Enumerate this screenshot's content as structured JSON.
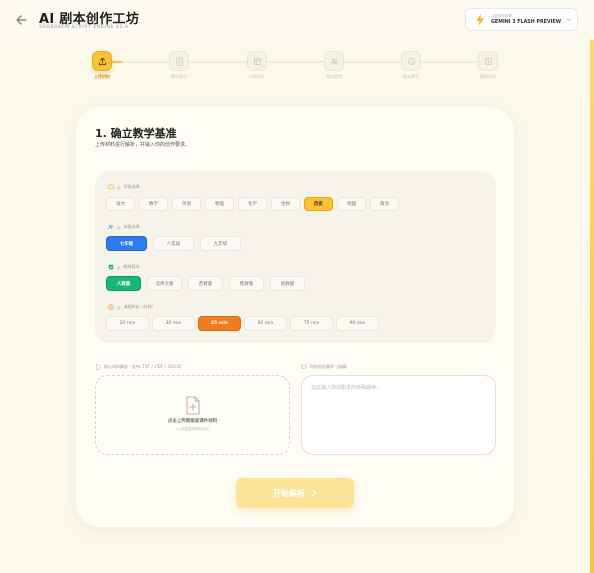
{
  "header": {
    "title": "AI 剧本创作工坊",
    "subtitle": "SOURDACM SCRIPT ENGINE V2.0",
    "model_picker": {
      "caption": "当前使用引擎",
      "model_name": "GEMINI 3 FLASH PREVIEW",
      "accent_color": "#f5b820"
    }
  },
  "stepper": {
    "progress_fraction": 0.0,
    "steps": [
      {
        "label": "上传材料",
        "icon": "upload-icon",
        "active": true
      },
      {
        "label": "教学要点",
        "icon": "doc-icon",
        "active": false
      },
      {
        "label": "大纲设计",
        "icon": "outline-icon",
        "active": false
      },
      {
        "label": "角色塑造",
        "icon": "people-icon",
        "active": false
      },
      {
        "label": "剧本撰写",
        "icon": "pen-icon",
        "active": false
      },
      {
        "label": "最终导出",
        "icon": "export-icon",
        "active": false
      }
    ]
  },
  "section": {
    "title": "1. 确立教学基准",
    "description": "上传材料进行解析，并输入你的创作要求。"
  },
  "options": {
    "subject": {
      "label": "学科选择",
      "selected": "历史",
      "items": [
        "语文",
        "数学",
        "英语",
        "物理",
        "化学",
        "生物",
        "历史",
        "地理",
        "政治"
      ]
    },
    "grade": {
      "label": "年级选择",
      "selected": "七年级",
      "items": [
        "七年级",
        "八年级",
        "九年级"
      ]
    },
    "textbook": {
      "label": "教材版本",
      "selected": "人教版",
      "items": [
        "人教版",
        "北师大版",
        "苏教版",
        "鲁教版",
        "浙教版"
      ]
    },
    "duration": {
      "label": "课程时长（分钟）",
      "selected": "45 min",
      "items": [
        "20 min",
        "30 min",
        "45 min",
        "60 min",
        "75 min",
        "90 min"
      ]
    }
  },
  "upload": {
    "label": "核心材料解析（支持 .TXT / .PDF / .DOCX）",
    "main_text": "点击上传教案或课件材料",
    "hint": "AI 将智能提取知识点"
  },
  "notes": {
    "label": "你的创作要求（选填）",
    "placeholder": "在此输入你对剧本的特殊期待..."
  },
  "start_button": {
    "label": "开始解析"
  },
  "colors": {
    "brand_yellow": "#f8c231",
    "blue": "#2d7bf0",
    "green": "#17b675",
    "orange": "#f47b1d"
  }
}
